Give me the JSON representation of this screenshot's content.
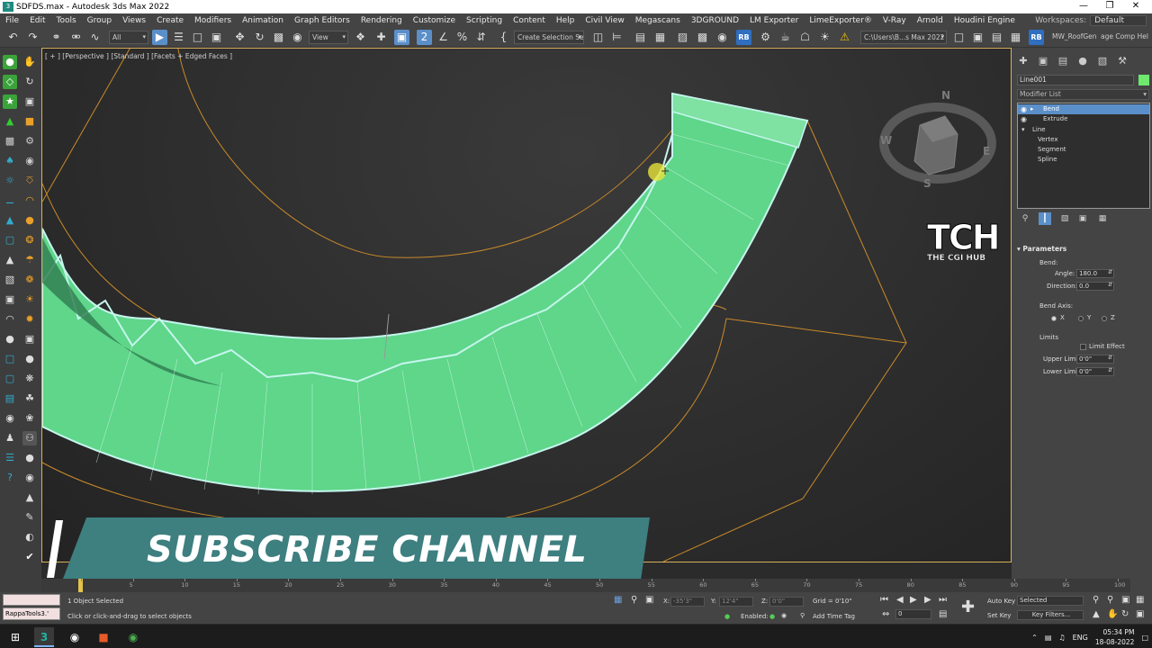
{
  "window": {
    "title": "SDFDS.max - Autodesk 3ds Max 2022",
    "app_icon": "3ds-max-icon",
    "controls": [
      "minimize",
      "maximize",
      "close"
    ]
  },
  "menubar": {
    "items": [
      "File",
      "Edit",
      "Tools",
      "Group",
      "Views",
      "Create",
      "Modifiers",
      "Animation",
      "Graph Editors",
      "Rendering",
      "Customize",
      "Scripting",
      "Content",
      "Help",
      "Civil View",
      "Megascans",
      "3DGROUND",
      "LM Exporter",
      "LimeExporter®",
      "V-Ray",
      "Arnold",
      "Houdini Engine"
    ],
    "workspace_label": "Workspaces:",
    "workspace_value": "Default"
  },
  "toolbar": {
    "selection_filter": "All",
    "ref_coord": "View",
    "named_selection": "Create Selection Se",
    "project_path": "C:\\Users\\B...s Max 2022",
    "rb_label": "RB",
    "roof_gen": "MW_RoofGen",
    "comp_help": "age Comp Hel"
  },
  "viewport": {
    "label": "[ + ] [Perspective ] [Standard ] [Facets + Edged Faces ]",
    "viewcube_letters": {
      "n": "N",
      "e": "E",
      "s": "S",
      "w": "W"
    },
    "accent_color": "#5fd68a",
    "edge_color": "#c6f5ee",
    "bbox_color": "#c98a2a"
  },
  "watermark": {
    "big": "TCH",
    "small": "THE CGI HUB"
  },
  "banner": {
    "text": "SUBSCRIBE CHANNEL",
    "color": "#3e7f80"
  },
  "command_panel": {
    "object_name": "Line001",
    "object_color": "#6ee86e",
    "modifier_list": "Modifier List",
    "stack": [
      {
        "label": "Bend",
        "selected": true
      },
      {
        "label": "Extrude",
        "selected": false
      },
      {
        "label": "Line",
        "selected": false
      },
      {
        "label": "Vertex",
        "selected": false
      },
      {
        "label": "Segment",
        "selected": false
      },
      {
        "label": "Spline",
        "selected": false
      }
    ],
    "parameters": {
      "header": "Parameters",
      "bend_label": "Bend:",
      "angle_label": "Angle:",
      "angle_value": "180.0",
      "direction_label": "Direction:",
      "direction_value": "0.0",
      "axis_label": "Bend Axis:",
      "axis_x": "X",
      "axis_y": "Y",
      "axis_z": "Z",
      "axis_selected": "X",
      "limits_label": "Limits",
      "limit_effect": "Limit Effect",
      "upper_label": "Upper Limit:",
      "upper_value": "0'0\"",
      "lower_label": "Lower Limit:",
      "lower_value": "0'0\""
    }
  },
  "timeline": {
    "ticks": [
      0,
      5,
      10,
      15,
      20,
      25,
      30,
      35,
      40,
      45,
      50,
      55,
      60,
      65,
      70,
      75,
      80,
      85,
      90,
      95,
      100
    ],
    "frame_counter": "0 / 100"
  },
  "statusbar": {
    "script_text": "RappaTools3.'",
    "selected_count": "1 Object Selected",
    "prompt": "Click or click-and-drag to select objects",
    "x_label": "X:",
    "x_value": "-35'3\"",
    "y_label": "Y:",
    "y_value": "12'4\"",
    "z_label": "Z:",
    "z_value": "0'0\"",
    "grid": "Grid = 0'10\"",
    "enabled_label": "Enabled:",
    "add_time_tag": "Add Time Tag",
    "auto_key": "Auto Key",
    "selected_dd": "Selected",
    "set_key": "Set Key",
    "key_filters": "Key Filters...",
    "frame_value": "0"
  },
  "taskbar": {
    "language": "ENG",
    "time": "05:34 PM",
    "date": "18-08-2022"
  }
}
